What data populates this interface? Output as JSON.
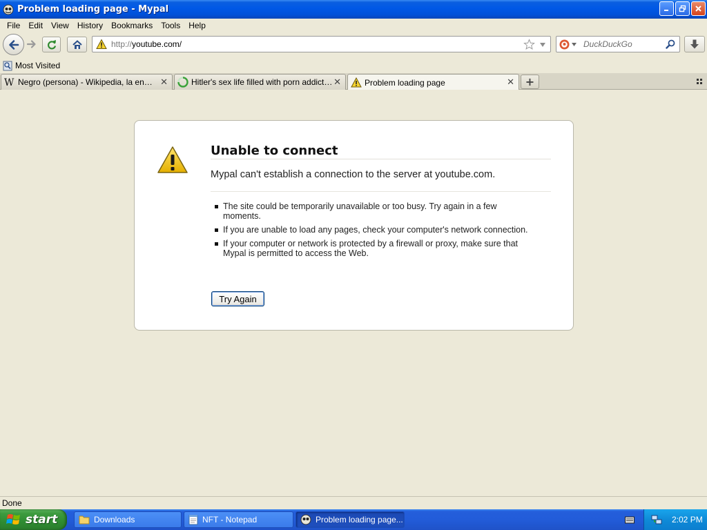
{
  "window": {
    "title": "Problem loading page - Mypal"
  },
  "menu": [
    "File",
    "Edit",
    "View",
    "History",
    "Bookmarks",
    "Tools",
    "Help"
  ],
  "nav": {
    "url_proto": "http://",
    "url_host": "youtube.com/",
    "search_placeholder": "DuckDuckGo"
  },
  "bookmarks": {
    "most_visited": "Most Visited"
  },
  "tabs": [
    {
      "label": "Negro (persona) - Wikipedia, la enciclope..."
    },
    {
      "label": "Hitler's sex life filled with porn addiction, i..."
    },
    {
      "label": "Problem loading page"
    }
  ],
  "error": {
    "title": "Unable to connect",
    "message": "Mypal can't establish a connection to the server at youtube.com.",
    "items": [
      "The site could be temporarily unavailable or too busy. Try again in a few moments.",
      "If you are unable to load any pages, check your computer's network connection.",
      "If your computer or network is protected by a firewall or proxy, make sure that Mypal is permitted to access the Web."
    ],
    "button": "Try Again"
  },
  "status": {
    "text": "Done"
  },
  "taskbar": {
    "start": "start",
    "items": [
      {
        "label": "Downloads"
      },
      {
        "label": "NFT - Notepad"
      },
      {
        "label": "Problem loading page..."
      }
    ],
    "clock": "2:02 PM"
  },
  "colors": {
    "titlebar": "#0058e6",
    "taskbar": "#245edb",
    "start_green": "#3d9b3f",
    "chrome_bg": "#ece9d8"
  }
}
